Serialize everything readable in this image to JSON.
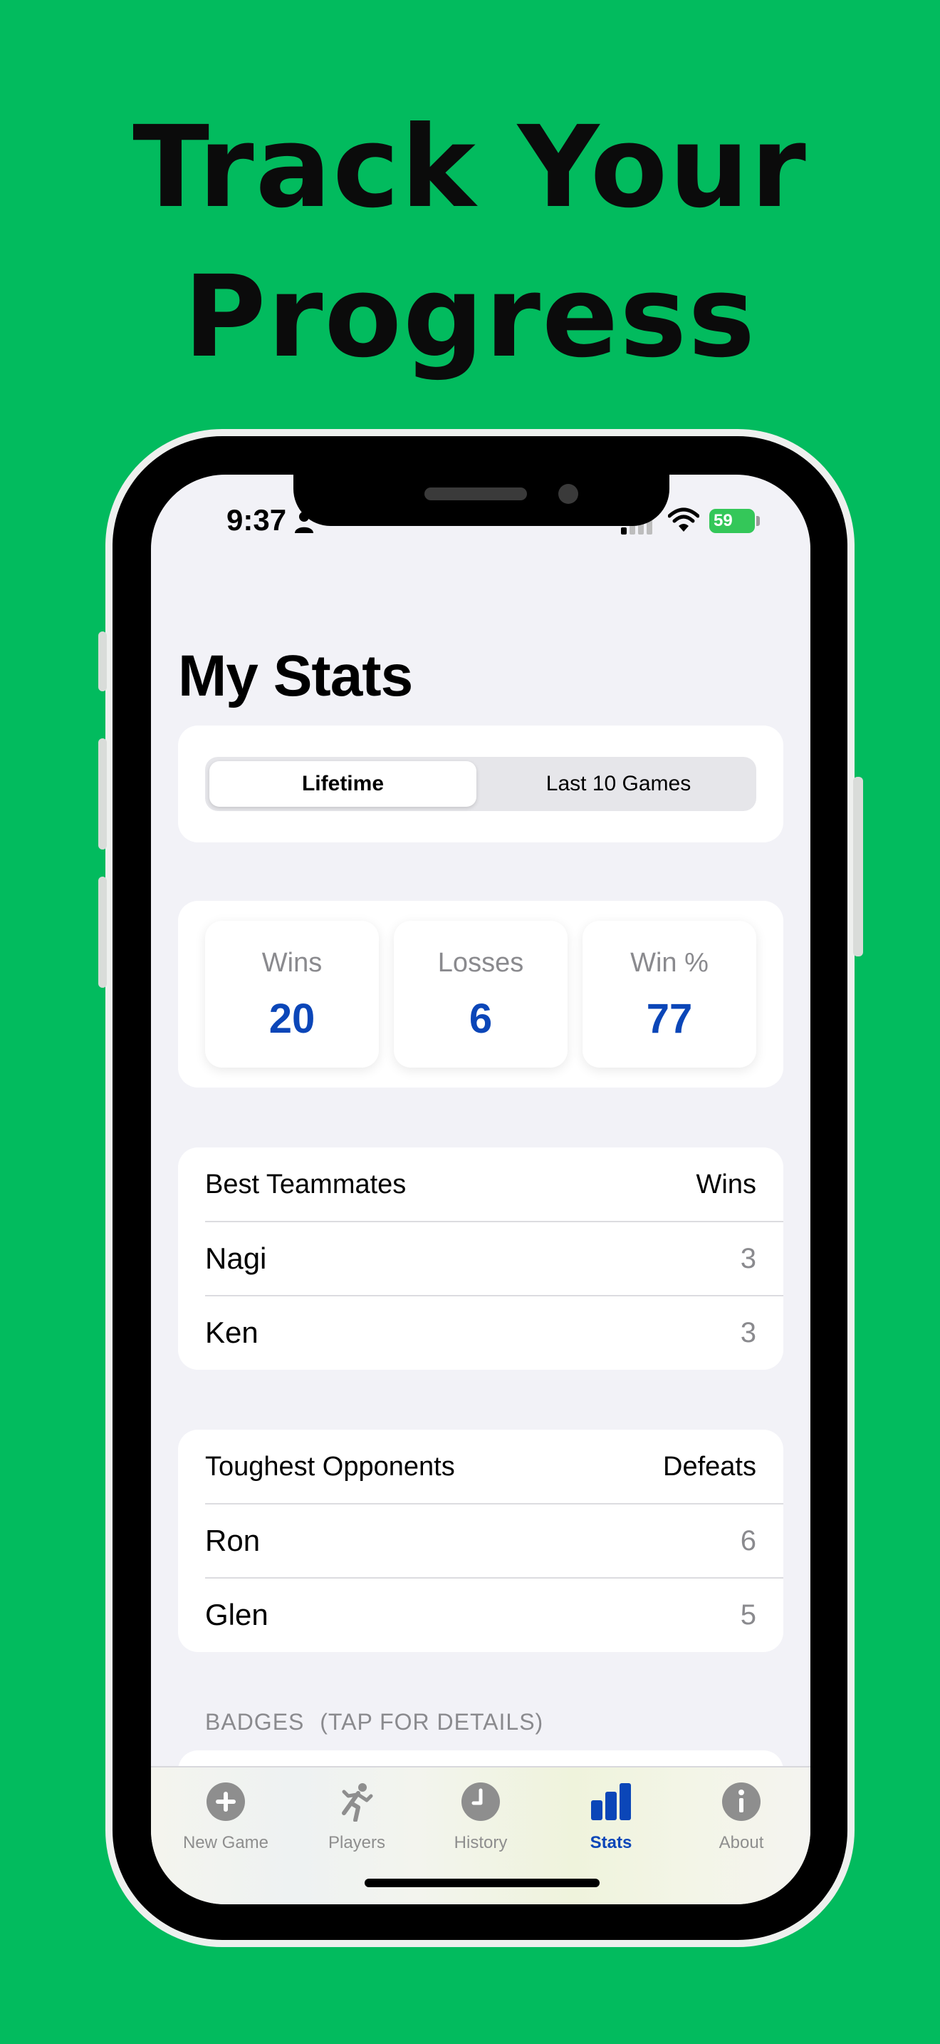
{
  "promo": {
    "headline_line1": "Track Your",
    "headline_line2": "Progress"
  },
  "status_bar": {
    "time": "9:37",
    "battery": "59"
  },
  "page": {
    "title": "My Stats"
  },
  "segmented_control": {
    "selected": "Lifetime",
    "options": [
      "Lifetime",
      "Last 10 Games"
    ]
  },
  "summary": {
    "wins_label": "Wins",
    "wins_value": "20",
    "losses_label": "Losses",
    "losses_value": "6",
    "winpct_label": "Win %",
    "winpct_value": "77"
  },
  "teammates": {
    "header": "Best Teammates",
    "column": "Wins",
    "rows": [
      {
        "name": "Nagi",
        "value": "3"
      },
      {
        "name": "Ken",
        "value": "3"
      }
    ]
  },
  "opponents": {
    "header": "Toughest Opponents",
    "column": "Defeats",
    "rows": [
      {
        "name": "Ron",
        "value": "6"
      },
      {
        "name": "Glen",
        "value": "5"
      }
    ]
  },
  "badges": {
    "caption": "BADGES",
    "hint": "(TAP FOR DETAILS)"
  },
  "tab_bar": {
    "tabs": [
      {
        "label": "New Game",
        "icon": "plus-circle-icon"
      },
      {
        "label": "Players",
        "icon": "running-person-icon"
      },
      {
        "label": "History",
        "icon": "clock-icon"
      },
      {
        "label": "Stats",
        "icon": "bar-chart-icon"
      },
      {
        "label": "About",
        "icon": "info-icon"
      }
    ],
    "selected": "Stats"
  },
  "colors": {
    "background": "#02bb5e",
    "accent": "#0b46b8",
    "secondary_text": "#8a8a8e"
  }
}
